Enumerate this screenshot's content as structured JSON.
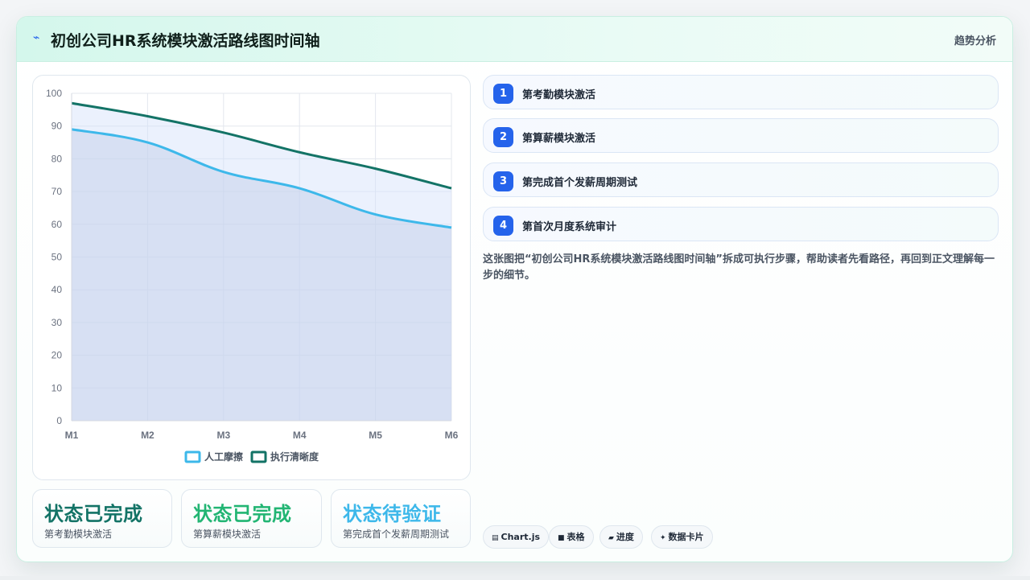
{
  "header": {
    "icon": "spark-icon",
    "title": "初创公司HR系统模块激活路线图时间轴",
    "right_label": "趋势分析"
  },
  "chart_data": {
    "type": "area",
    "categories": [
      "M1",
      "M2",
      "M3",
      "M4",
      "M5",
      "M6"
    ],
    "series": [
      {
        "name": "人工摩擦",
        "values": [
          89,
          85,
          76,
          71,
          63,
          59
        ],
        "color": "#3db8ea",
        "fill": "rgba(190,205,230,0.45)"
      },
      {
        "name": "执行清晰度",
        "values": [
          97,
          93,
          88,
          82,
          77,
          71
        ],
        "color": "#137366",
        "fill": "rgba(210,225,250,0.45)"
      }
    ],
    "ylim": [
      0,
      100
    ],
    "yticks": [
      0,
      10,
      20,
      30,
      40,
      50,
      60,
      70,
      80,
      90,
      100
    ],
    "grid": true,
    "legend": "bottom"
  },
  "status_cards": [
    {
      "title": "状态已完成",
      "subtitle": "第考勤模块激活",
      "color": "#137366"
    },
    {
      "title": "状态已完成",
      "subtitle": "第算薪模块激活",
      "color": "#22b573"
    },
    {
      "title": "状态待验证",
      "subtitle": "第完成首个发薪周期测试",
      "color": "#3db8ea"
    }
  ],
  "steps": [
    {
      "num": "1",
      "label": "第考勤模块激活"
    },
    {
      "num": "2",
      "label": "第算薪模块激活"
    },
    {
      "num": "3",
      "label": "第完成首个发薪周期测试"
    },
    {
      "num": "4",
      "label": "第首次月度系统审计"
    }
  ],
  "description": "这张图把“初创公司HR系统模块激活路线图时间轴”拆成可执行步骤，帮助读者先看路径，再回到正文理解每一步的细节。",
  "chips": [
    {
      "icon": "▤",
      "label": "Chart.js"
    },
    {
      "icon": "■",
      "label": "表格"
    },
    {
      "icon": "▰",
      "label": "进度"
    },
    {
      "icon": "✦",
      "label": "数据卡片"
    }
  ]
}
